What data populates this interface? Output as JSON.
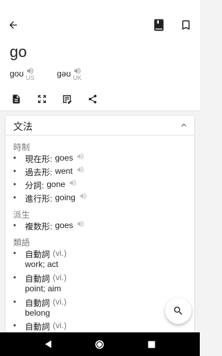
{
  "entry": {
    "word": "go",
    "pronunciations": [
      {
        "ipa": "goʊ",
        "region": "US"
      },
      {
        "ipa": "gəʊ",
        "region": "UK"
      }
    ]
  },
  "toolbar_icons": [
    "back-arrow-icon",
    "dictionary-book-icon",
    "bookmark-icon"
  ],
  "action_icons": [
    "document-icon",
    "fullscreen-icon",
    "edit-note-icon",
    "share-icon"
  ],
  "card": {
    "title": "文法",
    "sections": [
      {
        "title": "時制",
        "items": [
          {
            "label": "現在形:",
            "value": "goes"
          },
          {
            "label": "過去形:",
            "value": "went"
          },
          {
            "label": "分詞:",
            "value": "gone"
          },
          {
            "label": "進行形:",
            "value": "going"
          }
        ]
      },
      {
        "title": "派生",
        "items": [
          {
            "label": "複数形:",
            "value": "goes"
          }
        ]
      },
      {
        "title": "類語",
        "items": [
          {
            "pos": "自動詞",
            "tag": "(vi.)",
            "meaning": "work; act"
          },
          {
            "pos": "自動詞",
            "tag": "(vi.)",
            "meaning": "point; aim"
          },
          {
            "pos": "自動詞",
            "tag": "(vi.)",
            "meaning": "belong"
          },
          {
            "pos": "自動詞",
            "tag": "(vi.)",
            "meaning": ""
          }
        ]
      }
    ]
  },
  "colors": {
    "icon": "#212121",
    "muted": "#9e9e9e",
    "navbar": "#000000"
  }
}
